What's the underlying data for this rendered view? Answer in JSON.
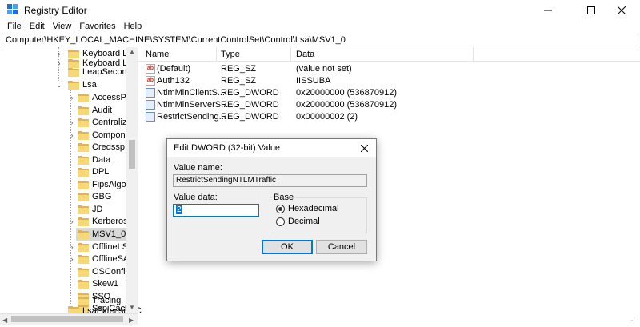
{
  "window": {
    "title": "Registry Editor"
  },
  "menu": [
    "File",
    "Edit",
    "View",
    "Favorites",
    "Help"
  ],
  "address": "Computer\\HKEY_LOCAL_MACHINE\\SYSTEM\\CurrentControlSet\\Control\\Lsa\\MSV1_0",
  "tree": {
    "items": [
      {
        "label": "Keyboard Layo"
      },
      {
        "label": "Keyboard Layo"
      },
      {
        "label": "LeapSecondIn"
      },
      {
        "label": "Lsa"
      },
      {
        "label": "AccessProv"
      },
      {
        "label": "Audit"
      },
      {
        "label": "Centralized"
      },
      {
        "label": "Componen"
      },
      {
        "label": "Credssp"
      },
      {
        "label": "Data"
      },
      {
        "label": "DPL"
      },
      {
        "label": "FipsAlgoritl"
      },
      {
        "label": "GBG"
      },
      {
        "label": "JD"
      },
      {
        "label": "Kerberos"
      },
      {
        "label": "MSV1_0"
      },
      {
        "label": "OfflineLSA"
      },
      {
        "label": "OfflineSAM"
      },
      {
        "label": "OSConfig"
      },
      {
        "label": "Skew1"
      },
      {
        "label": "SSO"
      },
      {
        "label": "SspiCache"
      },
      {
        "label": "Tracing"
      },
      {
        "label": "LsaExtensionC"
      }
    ]
  },
  "list": {
    "columns": {
      "name": "Name",
      "type": "Type",
      "data": "Data"
    },
    "rows": [
      {
        "icon": "string-value-icon",
        "name": "(Default)",
        "type": "REG_SZ",
        "data": "(value not set)"
      },
      {
        "icon": "string-value-icon",
        "name": "Auth132",
        "type": "REG_SZ",
        "data": "IISSUBA"
      },
      {
        "icon": "dword-value-icon",
        "name": "NtlmMinClientS...",
        "type": "REG_DWORD",
        "data": "0x20000000 (536870912)"
      },
      {
        "icon": "dword-value-icon",
        "name": "NtlmMinServerS...",
        "type": "REG_DWORD",
        "data": "0x20000000 (536870912)"
      },
      {
        "icon": "dword-value-icon",
        "name": "RestrictSending...",
        "type": "REG_DWORD",
        "data": "0x00000002 (2)"
      }
    ]
  },
  "dialog": {
    "title": "Edit DWORD (32-bit) Value",
    "value_name_label": "Value name:",
    "value_name": "RestrictSendingNTLMTraffic",
    "value_data_label": "Value data:",
    "value_data": "2",
    "base_label": "Base",
    "hex_label": "Hexadecimal",
    "dec_label": "Decimal",
    "selected_base": "Hexadecimal",
    "ok_label": "OK",
    "cancel_label": "Cancel"
  }
}
